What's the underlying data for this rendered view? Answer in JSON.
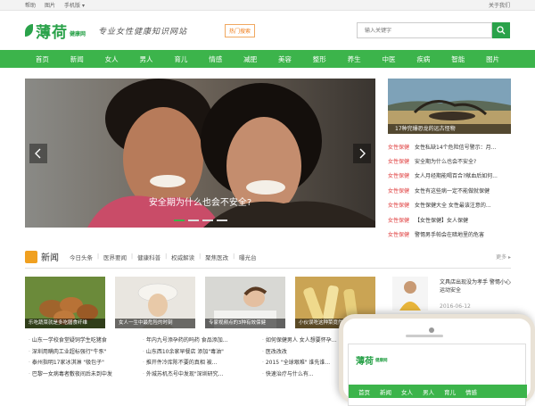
{
  "topbar": {
    "links": [
      "帮助",
      "图片",
      "手机版 ▾"
    ],
    "right": "关于我们"
  },
  "header": {
    "logo": "薄荷",
    "logo_sub": "健康网",
    "slogan": "专业女性健康知识网站",
    "hot_link": "热门搜索",
    "search_placeholder": "输入关键字"
  },
  "nav": [
    "首页",
    "新闻",
    "女人",
    "男人",
    "育儿",
    "情感",
    "减肥",
    "美容",
    "整形",
    "养生",
    "中医",
    "疾病",
    "智能",
    "图片"
  ],
  "hero": {
    "caption": "安全期为什么也会不安全?",
    "active_dot": 0,
    "dot_count": 4
  },
  "side": {
    "image_caption": "17种完爆恐龙的远古怪物",
    "items": [
      {
        "tag": "女性保健",
        "title": "女性私缺14个危险信号警示：月..."
      },
      {
        "tag": "女性保健",
        "title": "安全期为什么也会不安全?"
      },
      {
        "tag": "女性保健",
        "title": "女人月经期能喝百合?献血后如何..."
      },
      {
        "tag": "女性保健",
        "title": "女性有这些病一定不能做就保健"
      },
      {
        "tag": "女性保健",
        "title": "女性保健大全 女性最该注意的..."
      },
      {
        "tag": "女性保健",
        "title": "【女性保健】女人保健"
      },
      {
        "tag": "女性保健",
        "title": "警惕男手帕会在暗地里的危害"
      }
    ]
  },
  "news": {
    "title": "新闻",
    "subnav": [
      "今日头条",
      "医界要闻",
      "健康科普",
      "权威解读",
      "聚焦医改",
      "曝光台"
    ],
    "more": "更多 ▸",
    "thumbs": [
      "乐吃蔬菜就是多吃膳食纤维",
      "女人一生中最危险的时刻",
      "专家视频点的3种有效保健",
      "小伙误吃这种菜竟然能..."
    ],
    "featured_text": "文具店出现没为孝手 警惕小心运动安全",
    "featured_date": "2016-06-12",
    "col1": [
      "山东一学校食堂疑饲学生吃猪食",
      "深圳用瞒肉工业超标强行\"牛豕\"",
      "泰州指明17家冰淇淋 \"极包子\"",
      "巴黎一女病毒者敷夜间后未到中发"
    ],
    "col2": [
      "年内九号添孕药的吗药 食品添加...",
      "山东西10余家早餐店 添加\"毒油\"",
      "推开件冷库陈不要的真相 被...",
      "外城苏机杰号中发现\"深圳研究..."
    ],
    "col3": [
      "如何保健男人 女人想要怀孕…",
      "医改改改",
      "2015 \"全球艰难\" 谁先谁...",
      "快速治疗与什么有..."
    ]
  },
  "phone": {
    "logo": "薄荷",
    "logo_sub": "健康网",
    "nav": [
      "首页",
      "新闻",
      "女人",
      "男人",
      "育儿",
      "情感"
    ]
  }
}
